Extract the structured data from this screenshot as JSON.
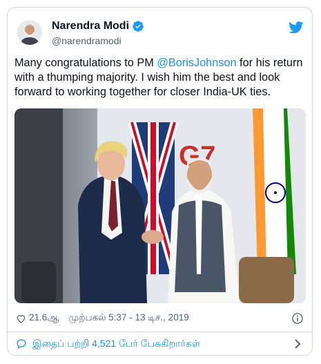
{
  "tweet": {
    "author_name": "Narendra Modi",
    "author_handle": "@narendramodi",
    "text_before": "Many congratulations to PM ",
    "mention": "@BorisJohnson",
    "text_after": " for his return with a thumping majority. I wish him the best and look forward to working together for closer India-UK ties.",
    "photo_logo_text": "G7",
    "likes": "21.6ஆ",
    "timestamp": "முற்பகல் 5:37 - 13 டிச., 2019",
    "conversation": "இதைப் பற்றி 4,521 பேர் பேசுகிறார்கள்"
  },
  "icons": {
    "verified": "verified-badge-icon",
    "bird": "twitter-bird-icon",
    "like": "heart-icon",
    "info": "info-icon",
    "reply": "speech-bubble-icon",
    "chevron": "chevron-right-icon"
  },
  "colors": {
    "accent": "#1b95e0",
    "text": "#0f1419",
    "secondary": "#536471",
    "border": "#cfd9de"
  }
}
